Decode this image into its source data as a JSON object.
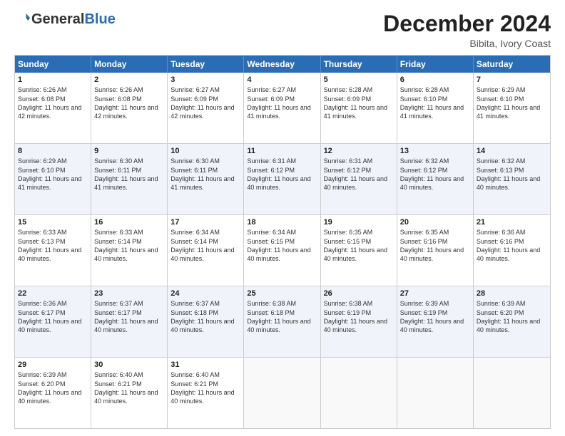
{
  "header": {
    "logo_general": "General",
    "logo_blue": "Blue",
    "month_year": "December 2024",
    "location": "Bibita, Ivory Coast"
  },
  "days_of_week": [
    "Sunday",
    "Monday",
    "Tuesday",
    "Wednesday",
    "Thursday",
    "Friday",
    "Saturday"
  ],
  "weeks": [
    [
      {
        "day": 1,
        "sunrise": "6:26 AM",
        "sunset": "6:08 PM",
        "daylight": "11 hours and 42 minutes."
      },
      {
        "day": 2,
        "sunrise": "6:26 AM",
        "sunset": "6:08 PM",
        "daylight": "11 hours and 42 minutes."
      },
      {
        "day": 3,
        "sunrise": "6:27 AM",
        "sunset": "6:09 PM",
        "daylight": "11 hours and 42 minutes."
      },
      {
        "day": 4,
        "sunrise": "6:27 AM",
        "sunset": "6:09 PM",
        "daylight": "11 hours and 41 minutes."
      },
      {
        "day": 5,
        "sunrise": "6:28 AM",
        "sunset": "6:09 PM",
        "daylight": "11 hours and 41 minutes."
      },
      {
        "day": 6,
        "sunrise": "6:28 AM",
        "sunset": "6:10 PM",
        "daylight": "11 hours and 41 minutes."
      },
      {
        "day": 7,
        "sunrise": "6:29 AM",
        "sunset": "6:10 PM",
        "daylight": "11 hours and 41 minutes."
      }
    ],
    [
      {
        "day": 8,
        "sunrise": "6:29 AM",
        "sunset": "6:10 PM",
        "daylight": "11 hours and 41 minutes."
      },
      {
        "day": 9,
        "sunrise": "6:30 AM",
        "sunset": "6:11 PM",
        "daylight": "11 hours and 41 minutes."
      },
      {
        "day": 10,
        "sunrise": "6:30 AM",
        "sunset": "6:11 PM",
        "daylight": "11 hours and 41 minutes."
      },
      {
        "day": 11,
        "sunrise": "6:31 AM",
        "sunset": "6:12 PM",
        "daylight": "11 hours and 40 minutes."
      },
      {
        "day": 12,
        "sunrise": "6:31 AM",
        "sunset": "6:12 PM",
        "daylight": "11 hours and 40 minutes."
      },
      {
        "day": 13,
        "sunrise": "6:32 AM",
        "sunset": "6:12 PM",
        "daylight": "11 hours and 40 minutes."
      },
      {
        "day": 14,
        "sunrise": "6:32 AM",
        "sunset": "6:13 PM",
        "daylight": "11 hours and 40 minutes."
      }
    ],
    [
      {
        "day": 15,
        "sunrise": "6:33 AM",
        "sunset": "6:13 PM",
        "daylight": "11 hours and 40 minutes."
      },
      {
        "day": 16,
        "sunrise": "6:33 AM",
        "sunset": "6:14 PM",
        "daylight": "11 hours and 40 minutes."
      },
      {
        "day": 17,
        "sunrise": "6:34 AM",
        "sunset": "6:14 PM",
        "daylight": "11 hours and 40 minutes."
      },
      {
        "day": 18,
        "sunrise": "6:34 AM",
        "sunset": "6:15 PM",
        "daylight": "11 hours and 40 minutes."
      },
      {
        "day": 19,
        "sunrise": "6:35 AM",
        "sunset": "6:15 PM",
        "daylight": "11 hours and 40 minutes."
      },
      {
        "day": 20,
        "sunrise": "6:35 AM",
        "sunset": "6:16 PM",
        "daylight": "11 hours and 40 minutes."
      },
      {
        "day": 21,
        "sunrise": "6:36 AM",
        "sunset": "6:16 PM",
        "daylight": "11 hours and 40 minutes."
      }
    ],
    [
      {
        "day": 22,
        "sunrise": "6:36 AM",
        "sunset": "6:17 PM",
        "daylight": "11 hours and 40 minutes."
      },
      {
        "day": 23,
        "sunrise": "6:37 AM",
        "sunset": "6:17 PM",
        "daylight": "11 hours and 40 minutes."
      },
      {
        "day": 24,
        "sunrise": "6:37 AM",
        "sunset": "6:18 PM",
        "daylight": "11 hours and 40 minutes."
      },
      {
        "day": 25,
        "sunrise": "6:38 AM",
        "sunset": "6:18 PM",
        "daylight": "11 hours and 40 minutes."
      },
      {
        "day": 26,
        "sunrise": "6:38 AM",
        "sunset": "6:19 PM",
        "daylight": "11 hours and 40 minutes."
      },
      {
        "day": 27,
        "sunrise": "6:39 AM",
        "sunset": "6:19 PM",
        "daylight": "11 hours and 40 minutes."
      },
      {
        "day": 28,
        "sunrise": "6:39 AM",
        "sunset": "6:20 PM",
        "daylight": "11 hours and 40 minutes."
      }
    ],
    [
      {
        "day": 29,
        "sunrise": "6:39 AM",
        "sunset": "6:20 PM",
        "daylight": "11 hours and 40 minutes."
      },
      {
        "day": 30,
        "sunrise": "6:40 AM",
        "sunset": "6:21 PM",
        "daylight": "11 hours and 40 minutes."
      },
      {
        "day": 31,
        "sunrise": "6:40 AM",
        "sunset": "6:21 PM",
        "daylight": "11 hours and 40 minutes."
      },
      null,
      null,
      null,
      null
    ]
  ]
}
